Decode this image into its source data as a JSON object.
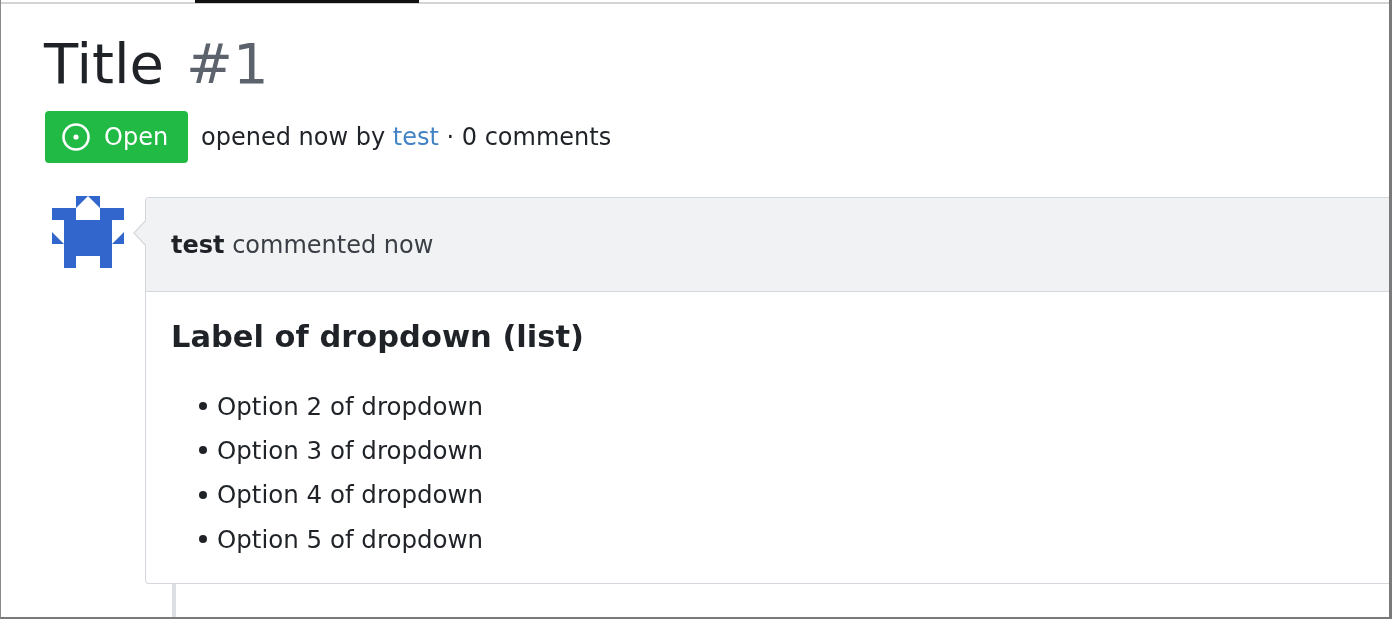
{
  "issue": {
    "title": "Title",
    "number": "#1",
    "state": {
      "kind": "open",
      "label": "Open"
    },
    "meta": {
      "before": "opened now by",
      "author": "test",
      "after": "· 0 comments"
    }
  },
  "comments": [
    {
      "author": "test",
      "action": "commented now",
      "heading": "Label of dropdown (list)",
      "items": [
        "Option 2 of dropdown",
        "Option 3 of dropdown",
        "Option 4 of dropdown",
        "Option 5 of dropdown"
      ]
    }
  ]
}
